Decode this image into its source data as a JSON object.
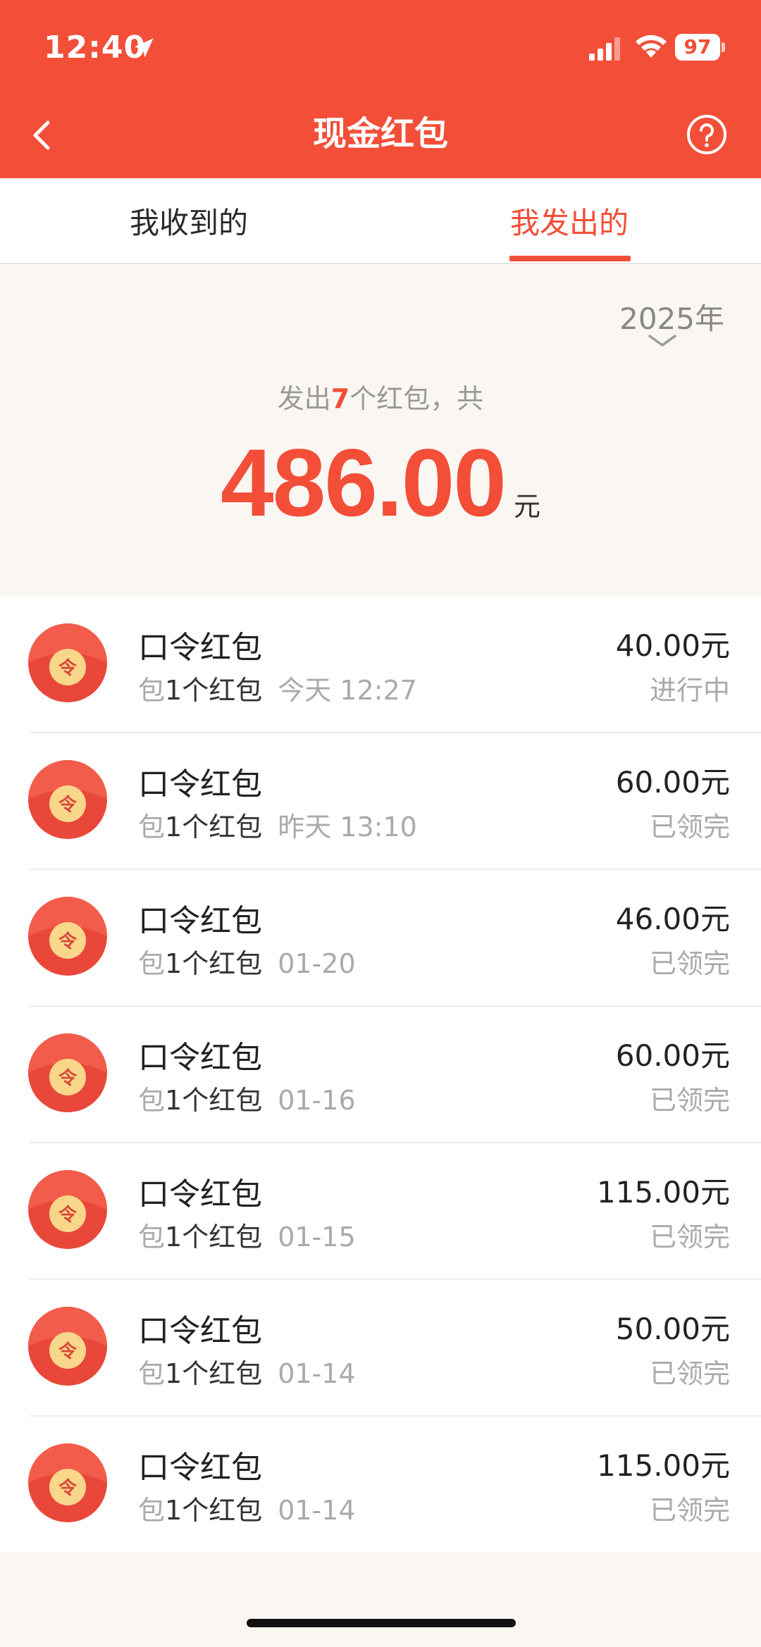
{
  "status_bar": {
    "time": "12:40",
    "battery": "97"
  },
  "header": {
    "title": "现金红包"
  },
  "tabs": [
    {
      "label": "我收到的",
      "active": false
    },
    {
      "label": "我发出的",
      "active": true
    }
  ],
  "summary": {
    "year": "2025年",
    "prefix": "发出",
    "count": "7",
    "suffix": "个红包，共",
    "total": "486.00",
    "unit": "元"
  },
  "colors": {
    "accent": "#F34E38",
    "coin": "#F8D78B"
  },
  "items": [
    {
      "title": "口令红包",
      "sub_prefix": "包",
      "count_label": "1个红包",
      "date": "今天 12:27",
      "amount": "40.00元",
      "status": "进行中"
    },
    {
      "title": "口令红包",
      "sub_prefix": "包",
      "count_label": "1个红包",
      "date": "昨天 13:10",
      "amount": "60.00元",
      "status": "已领完"
    },
    {
      "title": "口令红包",
      "sub_prefix": "包",
      "count_label": "1个红包",
      "date": "01-20",
      "amount": "46.00元",
      "status": "已领完"
    },
    {
      "title": "口令红包",
      "sub_prefix": "包",
      "count_label": "1个红包",
      "date": "01-16",
      "amount": "60.00元",
      "status": "已领完"
    },
    {
      "title": "口令红包",
      "sub_prefix": "包",
      "count_label": "1个红包",
      "date": "01-15",
      "amount": "115.00元",
      "status": "已领完"
    },
    {
      "title": "口令红包",
      "sub_prefix": "包",
      "count_label": "1个红包",
      "date": "01-14",
      "amount": "50.00元",
      "status": "已领完"
    },
    {
      "title": "口令红包",
      "sub_prefix": "包",
      "count_label": "1个红包",
      "date": "01-14",
      "amount": "115.00元",
      "status": "已领完"
    }
  ],
  "avatar_glyph": "令"
}
